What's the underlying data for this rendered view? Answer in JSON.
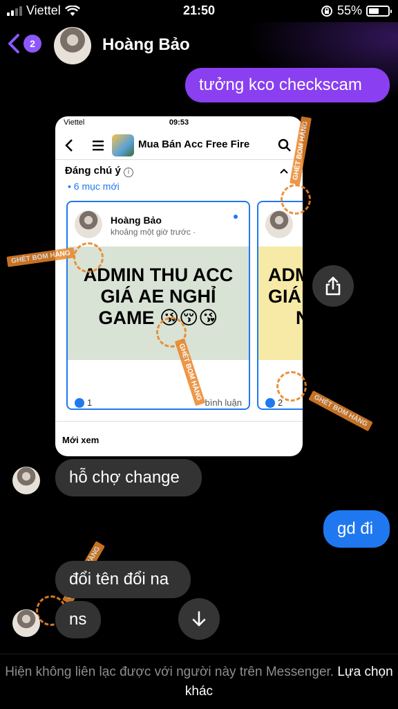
{
  "status": {
    "carrier": "Viettel",
    "time": "21:50",
    "battery": "55%",
    "battery_level": 0.55
  },
  "header": {
    "back_count": "2",
    "contact_name": "Hoàng Bảo"
  },
  "messages": [
    {
      "id": "m1",
      "direction": "outgoing",
      "text": "tưởng kco checkscam"
    },
    {
      "id": "m2",
      "direction": "incoming",
      "type": "image"
    },
    {
      "id": "m3",
      "direction": "incoming",
      "text": "hỗ chợ change"
    },
    {
      "id": "m4",
      "direction": "outgoing",
      "text": "gd đi"
    },
    {
      "id": "m5",
      "direction": "incoming",
      "text": "đổi tên đổi na"
    },
    {
      "id": "m6",
      "direction": "incoming",
      "text": "ns"
    }
  ],
  "shared_image": {
    "carrier": "Viettel",
    "time": "09:53",
    "group_title": "Mua Bán Acc Free Fire",
    "section_title": "Đáng chú ý",
    "section_sub": "• 6 mục mới",
    "card1": {
      "author": "Hoàng Bảo",
      "time": "khoảng một giờ trước ·",
      "banner_line1": "ADMIN THU ACC",
      "banner_line2": "GIÁ AE NGHỈ",
      "banner_line3": "GAME 😘😚😘",
      "likes": "1",
      "comments": "bình luận"
    },
    "card2": {
      "banner_line1": "ADM",
      "banner_line2": "GIÁ",
      "banner_line3": "N",
      "likes": "2"
    },
    "recent_label": "Mới xem"
  },
  "watermark_text": "GHÉT BOM HÀNG",
  "footer": {
    "notice": "Hiện không liên lạc được với người này trên Messenger.",
    "link": "Lựa chọn khác"
  },
  "colors": {
    "outgoing_purple": "#8a3ff0",
    "outgoing_blue": "#1f78f0",
    "incoming_gray": "#333333",
    "accent_purple": "#8c57ff"
  }
}
